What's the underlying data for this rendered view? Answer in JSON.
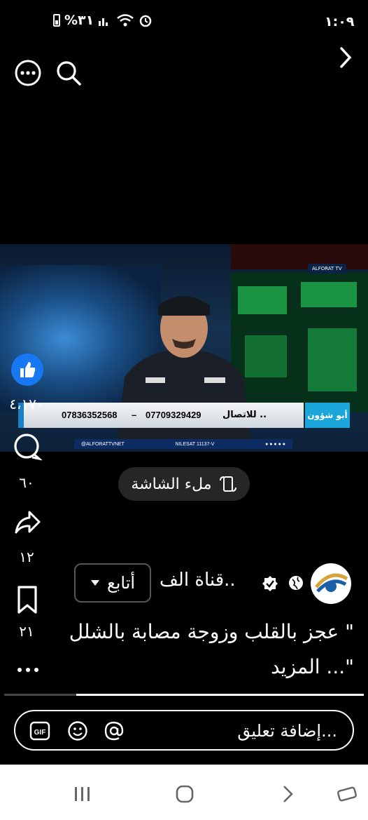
{
  "status_bar": {
    "time": "١:٠٩",
    "battery_text": "%٣١"
  },
  "top_bar": {
    "more_icon": "more-horizontal-circle-icon",
    "search_icon": "search-icon",
    "forward_icon": "chevron-right-icon"
  },
  "video": {
    "channel_logo": "ALFORAT TV",
    "ticker_label": "للاتصال ..",
    "ticker_phone_1": "07709329429",
    "ticker_dash": "–",
    "ticker_phone_2": "07836352568",
    "ticker_tag": "أبو شؤون",
    "sub_left": "@ALFORATTVNET",
    "sub_center": "NILESAT 11137-V"
  },
  "fill_screen": {
    "label": "ملء الشاشة"
  },
  "actions": {
    "likes": "٤،١٧٠",
    "comments": "٦٠",
    "shares": "١٢",
    "saves": "٢١"
  },
  "account": {
    "name": "قناة الف..",
    "follow_label": "أتابع"
  },
  "caption": {
    "text": "\" عجز بالقلب وزوجة مصابة بالشلل \"... المزيد"
  },
  "progress": {
    "fraction": 0.8
  },
  "comment": {
    "placeholder": "إضافة تعليق..."
  },
  "colors": {
    "like_blue": "#1877f2",
    "background": "#000000"
  }
}
